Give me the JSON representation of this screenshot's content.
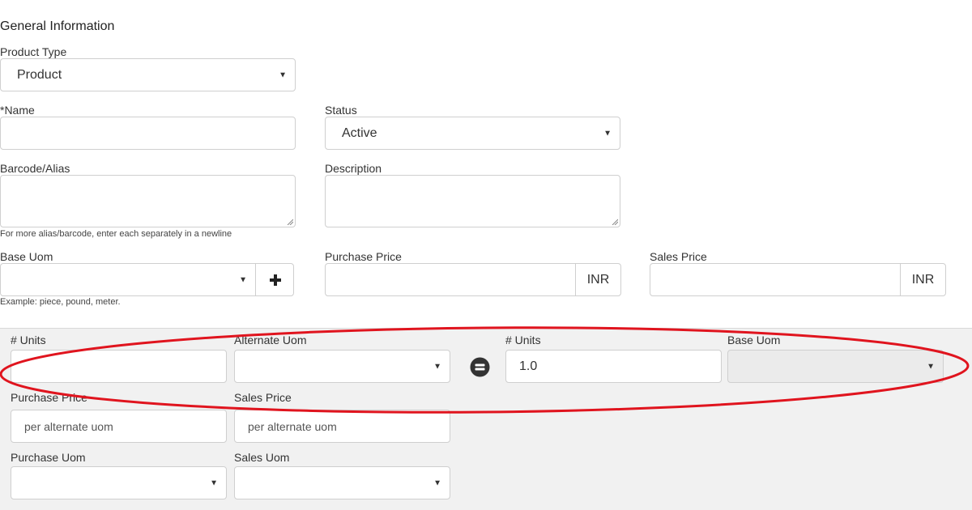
{
  "section_title": "General Information",
  "product_type": {
    "label": "Product Type",
    "value": "Product"
  },
  "name": {
    "label": "*Name",
    "value": ""
  },
  "status": {
    "label": "Status",
    "value": "Active"
  },
  "barcode": {
    "label": "Barcode/Alias",
    "help": "For more alias/barcode, enter each separately in a newline"
  },
  "description": {
    "label": "Description"
  },
  "base_uom": {
    "label": "Base Uom",
    "help": "Example: piece, pound, meter.",
    "add_icon": "plus-icon"
  },
  "purchase_price": {
    "label": "Purchase Price",
    "currency": "INR"
  },
  "sales_price": {
    "label": "Sales Price",
    "currency": "INR"
  },
  "alternate": {
    "units_label": "# Units",
    "alt_uom_label": "Alternate Uom",
    "equals_icon": "equals-icon",
    "base_units_label": "# Units",
    "base_units_value": "1.0",
    "base_uom_label": "Base Uom",
    "purchase_price_label": "Purchase Price",
    "purchase_price_placeholder": "per alternate uom",
    "sales_price_label": "Sales Price",
    "sales_price_placeholder": "per alternate uom",
    "purchase_uom_label": "Purchase Uom",
    "sales_uom_label": "Sales Uom"
  },
  "annotation": {
    "shape": "ellipse",
    "color": "#e0141e"
  }
}
